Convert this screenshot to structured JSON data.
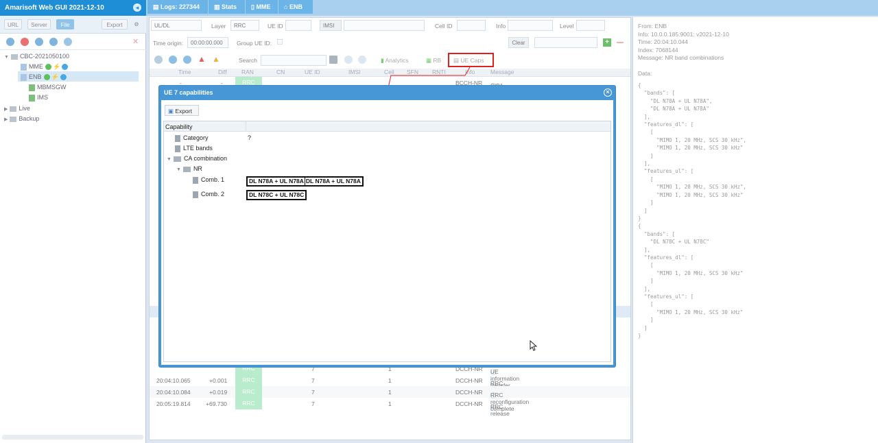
{
  "app": {
    "title": "Amarisoft Web GUI 2021-12-10"
  },
  "source_buttons": [
    "URL",
    "Server",
    "File",
    "Export"
  ],
  "tree": {
    "root": "CBC-2021050100",
    "nodes": [
      "MME",
      "ENB",
      "MBMSGW",
      "IMS"
    ],
    "live": "Live",
    "backup": "Backup"
  },
  "tabs": [
    {
      "label": "Logs: 227344"
    },
    {
      "label": "Stats"
    },
    {
      "label": "MME"
    },
    {
      "label": "ENB"
    }
  ],
  "filters": {
    "direction": "UL/DL",
    "layer_label": "Layer",
    "layer": "RRC",
    "ue_id_label": "UE ID",
    "imsi_label": "IMSI",
    "cell_id_label": "Cell ID",
    "info_label": "Info",
    "level_label": "Level",
    "time_origin_label": "Time origin:",
    "time_origin": "00:00:00.000",
    "group_ue_label": "Group UE ID:",
    "clear_label": "Clear"
  },
  "toolbar": {
    "search_label": "Search",
    "analytics": "Analytics",
    "rb": "RB",
    "ue_caps": "UE Caps"
  },
  "columns": [
    "Time",
    "Diff",
    "RAN",
    "CN",
    "UE ID",
    "IMSI",
    "Cell",
    "SFN",
    "RNTI",
    "Info",
    "Message"
  ],
  "log_rows": [
    {
      "time": "-",
      "diff": "-",
      "ran": "RRC",
      "ue": "",
      "cell": "",
      "info": "BCCH-NR",
      "msg": "SIB1"
    },
    {
      "time": "",
      "diff": "",
      "ran": "RRC",
      "ue": "7",
      "cell": "1",
      "info": "DCCH-NR",
      "msg": "UE information transfer"
    },
    {
      "time": "20:04:10.065",
      "diff": "+0.001",
      "ran": "RRC",
      "ue": "7",
      "cell": "1",
      "info": "DCCH-NR",
      "msg": "RRC reconfiguration"
    },
    {
      "time": "20:04:10.084",
      "diff": "+0.019",
      "ran": "RRC",
      "ue": "7",
      "cell": "1",
      "info": "DCCH-NR",
      "msg": "RRC reconfiguration complete"
    },
    {
      "time": "20:05:19.814",
      "diff": "+69.730",
      "ran": "RRC",
      "ue": "7",
      "cell": "1",
      "info": "DCCH-NR",
      "msg": "RRC release"
    }
  ],
  "modal": {
    "title": "UE 7 capabilities",
    "export": "Export",
    "header": "Capability",
    "category_label": "Category",
    "category_value": "?",
    "lte_bands": "LTE bands",
    "ca_combination": "CA combination",
    "nr": "NR",
    "combos": [
      {
        "label": "Comb. 1",
        "values": [
          "DL N78A + UL N78A",
          "DL N78A + UL N78A"
        ]
      },
      {
        "label": "Comb. 2",
        "values": [
          "DL N78C + UL N78C"
        ]
      }
    ]
  },
  "details": {
    "from": "From: ENB",
    "info": "Info: 10.0.0.185:9001: v2021-12-10",
    "time": "Time: 20:04:10.044",
    "index": "Index: 7068144",
    "message": "Message: NR band combinations",
    "data_label": "Data:",
    "json": "{\n  \"bands\": [\n    \"DL N78A + UL N78A\",\n    \"DL N78A + UL N78A\"\n  ],\n  \"features_dl\": [\n    [\n      \"MIMO 1, 20 MHz, SCS 30 kHz\",\n      \"MIMO 1, 20 MHz, SCS 30 kHz\"\n    ]\n  ],\n  \"features_ul\": [\n    [\n      \"MIMO 1, 20 MHz, SCS 30 kHz\",\n      \"MIMO 1, 20 MHz, SCS 30 kHz\"\n    ]\n  ]\n}\n{\n  \"bands\": [\n    \"DL N78C + UL N78C\"\n  ],\n  \"features_dl\": [\n    [\n      \"MIMO 1, 20 MHz, SCS 30 kHz\"\n    ]\n  ],\n  \"features_ul\": [\n    [\n      \"MIMO 1, 20 MHz, SCS 30 kHz\"\n    ]\n  ]\n}"
  },
  "colors": {
    "header_blue": "#1e8fd6",
    "rrc_green": "#b9eccc",
    "highlight_red": "#e02020"
  }
}
